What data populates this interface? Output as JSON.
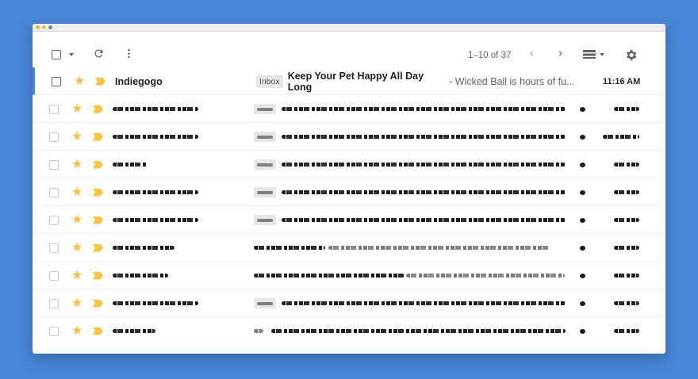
{
  "toolbar": {
    "select_icon": "checkbox-icon",
    "dropdown_icon": "caret-down-icon",
    "refresh_icon": "refresh-icon",
    "more_icon": "more-vert-icon",
    "pagination": "1–10 of 37",
    "prev_icon": "chevron-left-icon",
    "next_icon": "chevron-right-icon",
    "density_icon": "density-icon",
    "settings_icon": "gear-icon"
  },
  "emails": [
    {
      "sender": "Indiegogo",
      "label": "Inbox",
      "subject": "Keep Your Pet Happy All Day Long",
      "snippet": " - Wicked Ball is hours of fu...",
      "time": "11:16 AM",
      "starred": true,
      "important": true,
      "unread": true
    }
  ],
  "colors": {
    "background": "#4a86d8",
    "star": "#f5c04a",
    "important": "#f4c542",
    "selected_border": "#4a86d8"
  }
}
